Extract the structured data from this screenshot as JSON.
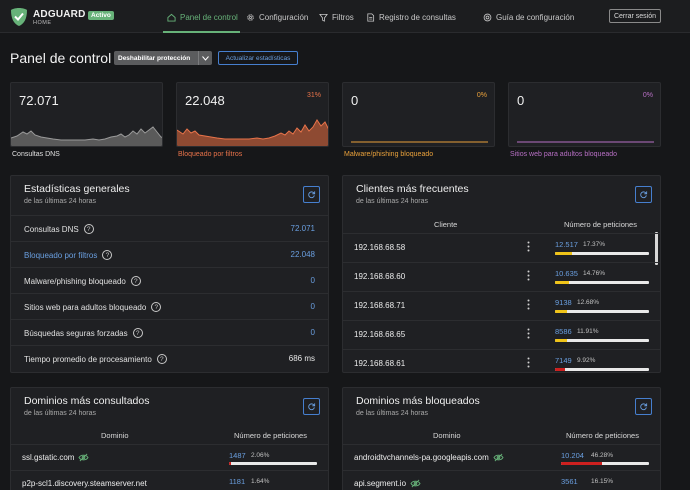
{
  "header": {
    "brand": "ADGUARD",
    "brand_sub": "HOME",
    "status_badge": "Activo",
    "nav": [
      {
        "label": "Panel de control",
        "icon": "dashboard-icon"
      },
      {
        "label": "Configuración",
        "icon": "gear-icon"
      },
      {
        "label": "Filtros",
        "icon": "filter-icon"
      },
      {
        "label": "Registro de consultas",
        "icon": "document-icon"
      },
      {
        "label": "Guía de configuración",
        "icon": "lifebuoy-icon"
      }
    ],
    "logout_label": "Cerrar sesión"
  },
  "title": "Panel de control",
  "buttons": {
    "disable_protection": "Deshabilitar protección",
    "refresh_stats": "Actualizar estadísticas"
  },
  "stat_cards": [
    {
      "value": "72.071",
      "pct": "",
      "label": "Consultas DNS",
      "color": "#9a9a9a"
    },
    {
      "value": "22.048",
      "pct": "31%",
      "label": "Bloqueado por filtros",
      "color": "#e8734a"
    },
    {
      "value": "0",
      "pct": "0%",
      "label": "Malware/phishing bloqueado",
      "color": "#e9a13b"
    },
    {
      "value": "0",
      "pct": "0%",
      "label": "Sitios web para adultos bloqueado",
      "color": "#b76fc4"
    }
  ],
  "general_stats": {
    "title": "Estadísticas generales",
    "subtitle": "de las últimas 24 horas",
    "rows": [
      {
        "label": "Consultas DNS",
        "value": "72.071"
      },
      {
        "label": "Bloqueado por filtros",
        "value": "22.048"
      },
      {
        "label": "Malware/phishing bloqueado",
        "value": "0"
      },
      {
        "label": "Sitios web para adultos bloqueado",
        "value": "0"
      },
      {
        "label": "Búsquedas seguras forzadas",
        "value": "0"
      },
      {
        "label": "Tiempo promedio de procesamiento",
        "value": "686 ms"
      }
    ]
  },
  "top_clients": {
    "title": "Clientes más frecuentes",
    "subtitle": "de las últimas 24 horas",
    "col_client": "Cliente",
    "col_requests": "Número de peticiones",
    "rows": [
      {
        "ip": "192.168.68.58",
        "count": "12.517",
        "pct": "17.37%",
        "fraction": 0.1737,
        "bar_color": "#f0c419"
      },
      {
        "ip": "192.168.68.60",
        "count": "10.635",
        "pct": "14.76%",
        "fraction": 0.1476,
        "bar_color": "#f0c419"
      },
      {
        "ip": "192.168.68.71",
        "count": "9138",
        "pct": "12.68%",
        "fraction": 0.1268,
        "bar_color": "#f0c419"
      },
      {
        "ip": "192.168.68.65",
        "count": "8586",
        "pct": "11.91%",
        "fraction": 0.1191,
        "bar_color": "#f0c419"
      },
      {
        "ip": "192.168.68.61",
        "count": "7149",
        "pct": "9.92%",
        "fraction": 0.0992,
        "bar_color": "#cd201f"
      }
    ]
  },
  "top_domains": {
    "title": "Dominios más consultados",
    "subtitle": "de las últimas 24 horas",
    "col_domain": "Dominio",
    "col_requests": "Número de peticiones",
    "rows": [
      {
        "domain": "ssl.gstatic.com",
        "count": "1487",
        "pct": "2.06%",
        "fraction": 0.0206
      },
      {
        "domain": "p2p-scl1.discovery.steamserver.net",
        "count": "1181",
        "pct": "1.64%",
        "fraction": 0.0164
      }
    ]
  },
  "top_blocked": {
    "title": "Dominios más bloqueados",
    "subtitle": "de las últimas 24 horas",
    "col_domain": "Dominio",
    "col_requests": "Número de peticiones",
    "rows": [
      {
        "domain": "androidtvchannels-pa.googleapis.com",
        "count": "10.204",
        "pct": "46.28%",
        "fraction": 0.4628,
        "bar_color": "#cd201f"
      },
      {
        "domain": "api.segment.io",
        "count": "3561",
        "pct": "16.15%",
        "fraction": 0.1615,
        "bar_color": "#cd201f"
      }
    ]
  },
  "colors": {
    "accent_green": "#67b279",
    "link_blue": "#6a9fe0",
    "panel_bg": "#1f2023",
    "page_bg": "#161719"
  }
}
